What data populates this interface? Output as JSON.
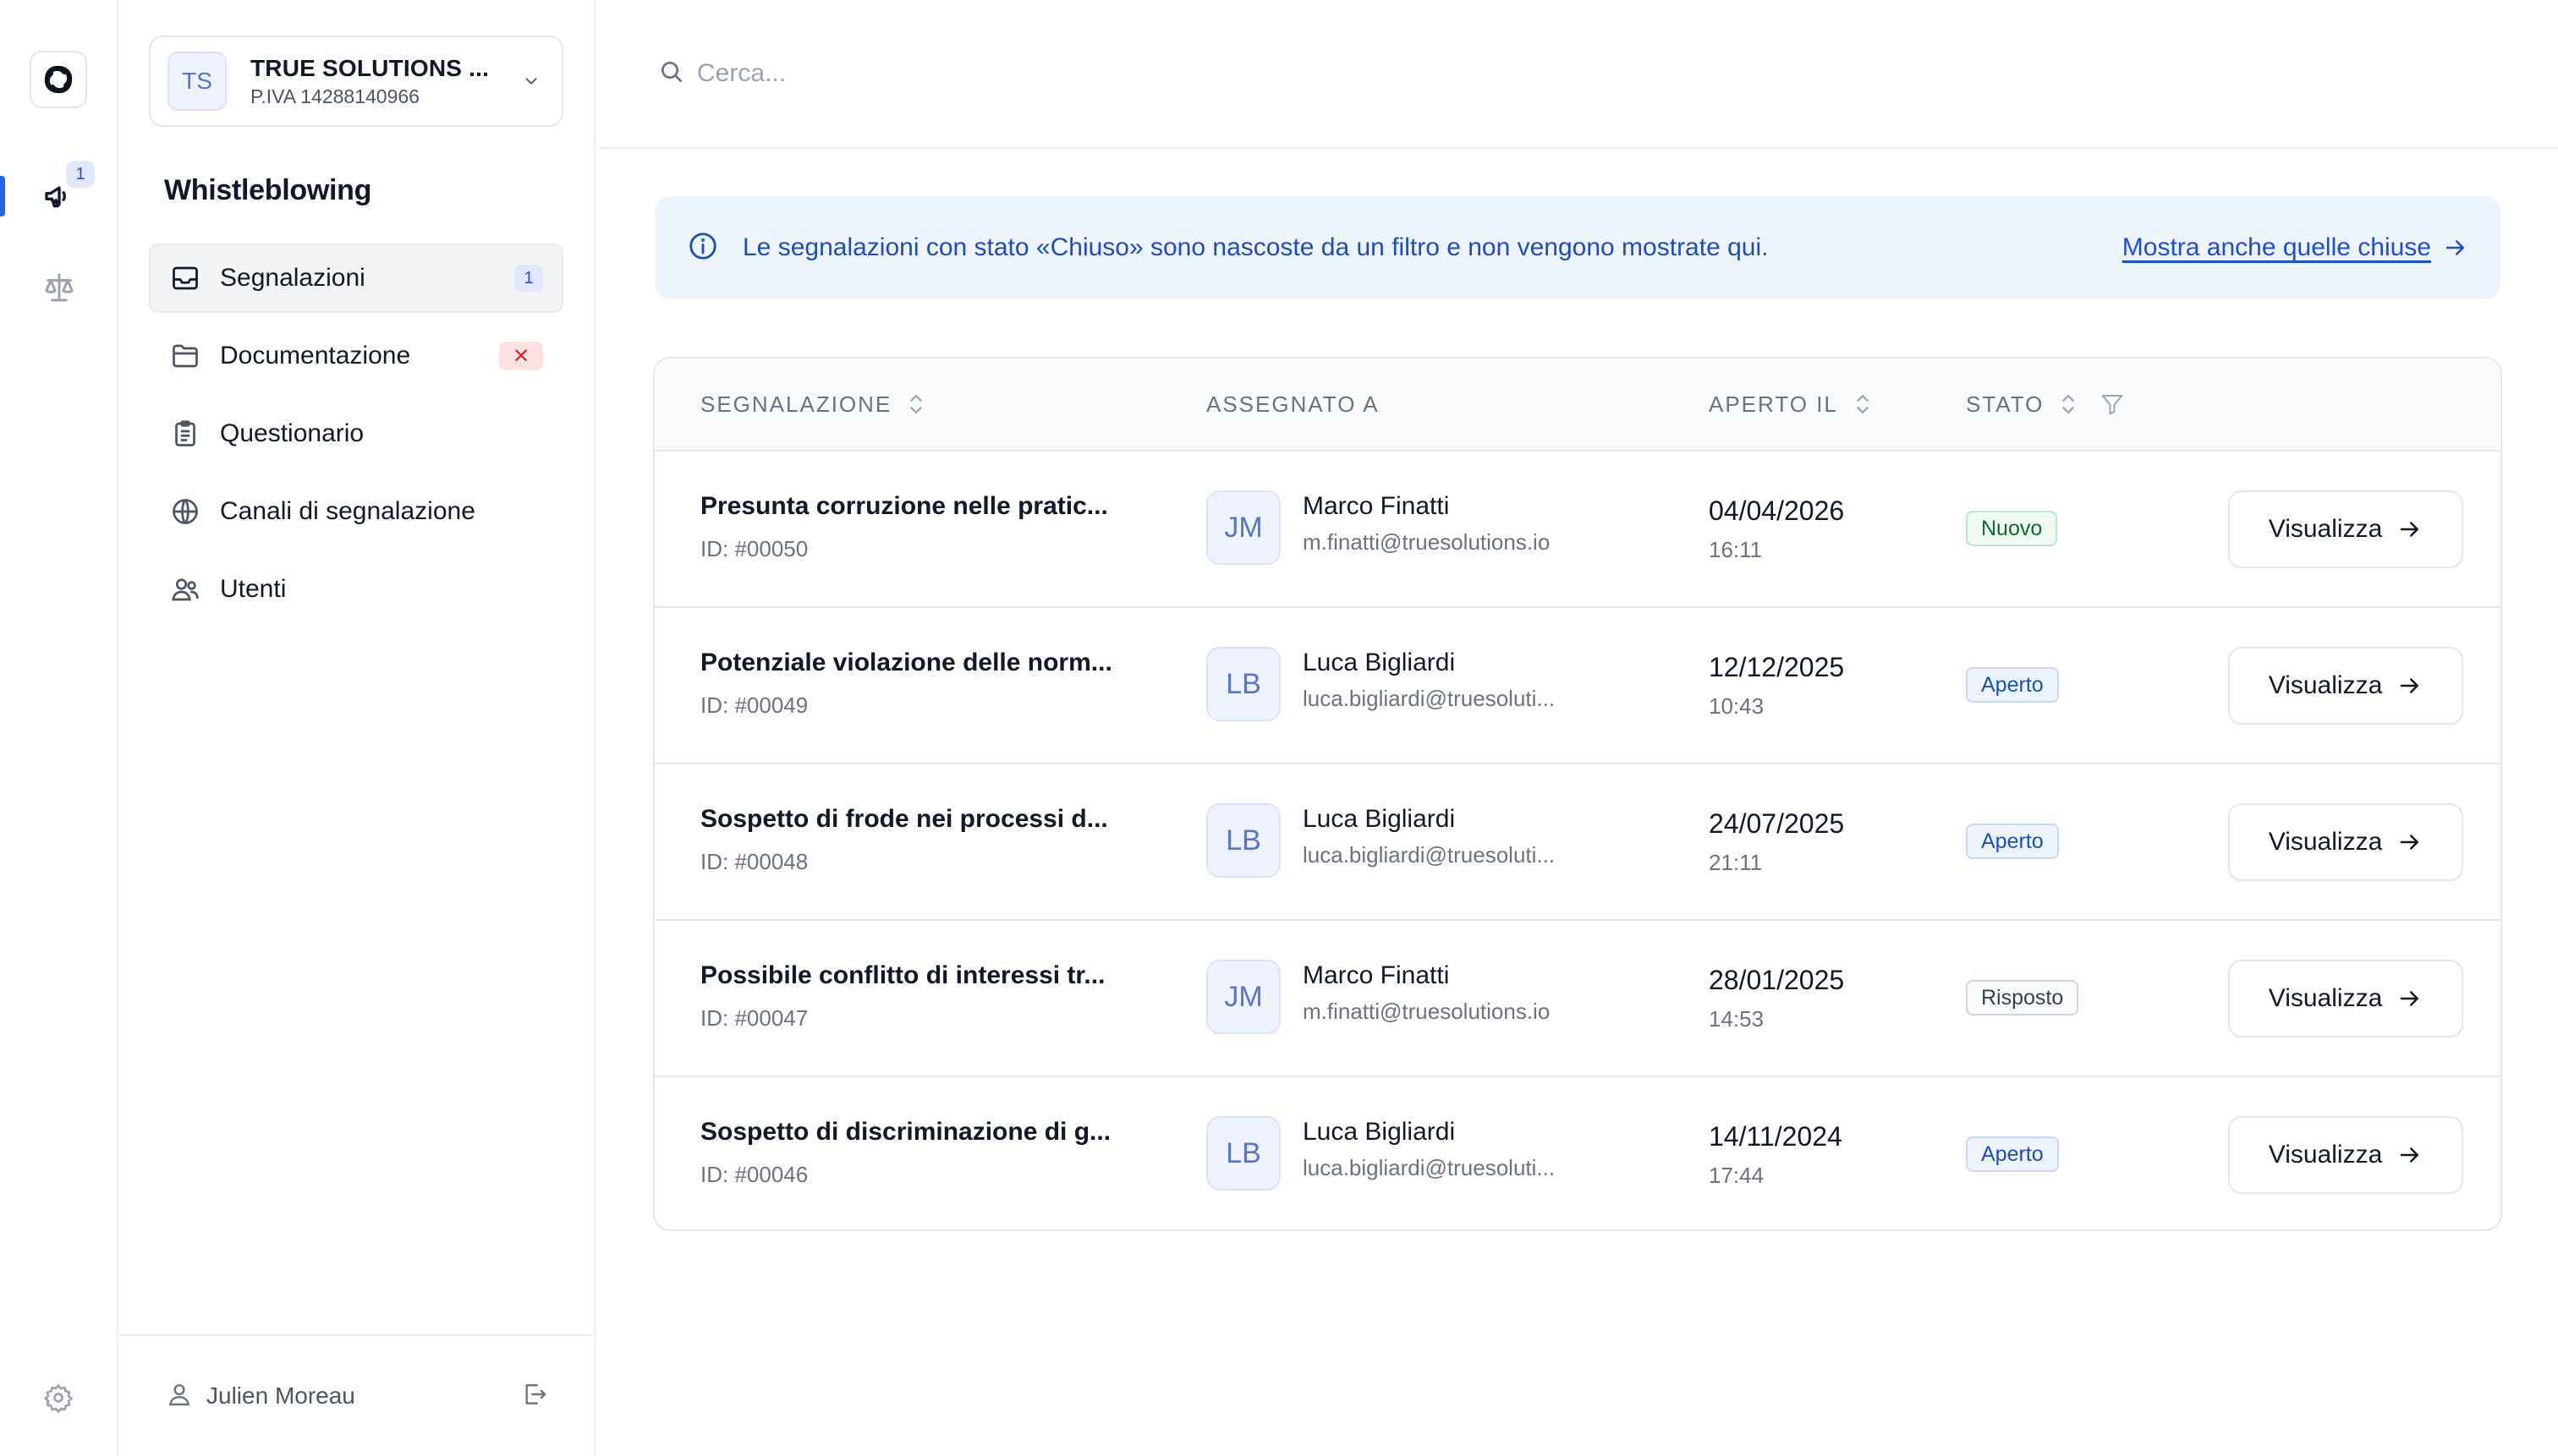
{
  "rail": {
    "badge_count": "1",
    "icons": [
      "app-logo",
      "megaphone-icon",
      "scale-icon",
      "gear-icon"
    ]
  },
  "org": {
    "initials": "TS",
    "name": "TRUE SOLUTIONS ...",
    "vat": "P.IVA 14288140966"
  },
  "sidebar": {
    "section_title": "Whistleblowing",
    "items": [
      {
        "label": "Segnalazioni",
        "icon": "inbox-icon",
        "count": "1"
      },
      {
        "label": "Documentazione",
        "icon": "folder-icon",
        "flag": "✕"
      },
      {
        "label": "Questionario",
        "icon": "clipboard-icon"
      },
      {
        "label": "Canali di segnalazione",
        "icon": "globe-icon"
      },
      {
        "label": "Utenti",
        "icon": "users-icon"
      }
    ],
    "user_name": "Julien Moreau"
  },
  "search": {
    "placeholder": "Cerca..."
  },
  "info_banner": {
    "text": "Le segnalazioni con stato «Chiuso» sono nascoste da un filtro e non vengono mostrate qui.",
    "link": "Mostra anche quelle chiuse"
  },
  "table": {
    "headers": {
      "report": "SEGNALAZIONE",
      "assignee": "ASSEGNATO A",
      "opened": "APERTO IL",
      "status": "STATO"
    },
    "rows": [
      {
        "title": "Presunta corruzione nelle pratic...",
        "id": "ID: #00050",
        "initials": "JM",
        "name": "Marco Finatti",
        "email": "m.finatti@truesolutions.io",
        "date": "04/04/2026",
        "time": "16:11",
        "status": "Nuovo",
        "status_kind": "nuovo",
        "action": "Visualizza"
      },
      {
        "title": "Potenziale violazione delle norm...",
        "id": "ID: #00049",
        "initials": "LB",
        "name": "Luca Bigliardi",
        "email": "luca.bigliardi@truesoluti...",
        "date": "12/12/2025",
        "time": "10:43",
        "status": "Aperto",
        "status_kind": "aperto",
        "action": "Visualizza"
      },
      {
        "title": "Sospetto di frode nei processi d...",
        "id": "ID: #00048",
        "initials": "LB",
        "name": "Luca Bigliardi",
        "email": "luca.bigliardi@truesoluti...",
        "date": "24/07/2025",
        "time": "21:11",
        "status": "Aperto",
        "status_kind": "aperto",
        "action": "Visualizza"
      },
      {
        "title": "Possibile conflitto di interessi tr...",
        "id": "ID: #00047",
        "initials": "JM",
        "name": "Marco Finatti",
        "email": "m.finatti@truesolutions.io",
        "date": "28/01/2025",
        "time": "14:53",
        "status": "Risposto",
        "status_kind": "risposto",
        "action": "Visualizza"
      },
      {
        "title": "Sospetto di discriminazione di g...",
        "id": "ID: #00046",
        "initials": "LB",
        "name": "Luca Bigliardi",
        "email": "luca.bigliardi@truesoluti...",
        "date": "14/11/2024",
        "time": "17:44",
        "status": "Aperto",
        "status_kind": "aperto",
        "action": "Visualizza"
      }
    ]
  },
  "colors": {
    "accent": "#2563eb",
    "banner_bg": "#eef4fe",
    "banner_text": "#1e4fb8"
  }
}
